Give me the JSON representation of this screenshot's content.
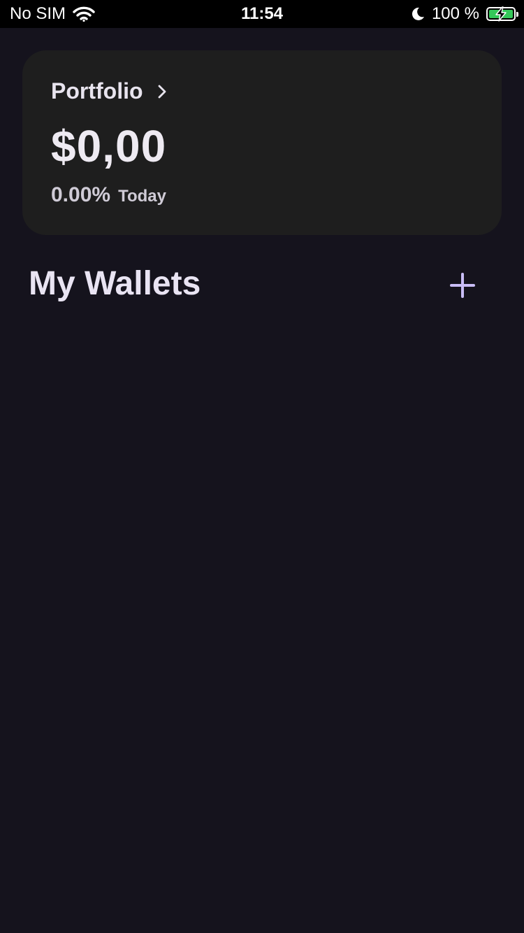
{
  "status_bar": {
    "carrier": "No SIM",
    "time": "11:54",
    "battery_percent": "100 %",
    "icons": [
      "wifi-icon",
      "moon-icon",
      "battery-charging-icon"
    ]
  },
  "portfolio": {
    "title": "Portfolio",
    "value": "$0,00",
    "change_percent": "0.00%",
    "change_period": "Today",
    "chevron_icon": "chevron-right-icon"
  },
  "wallets": {
    "title": "My Wallets",
    "add_icon": "plus-icon"
  },
  "colors": {
    "background": "#15131d",
    "card": "#1e1e1e",
    "accent": "#c9bdf6",
    "battery_green": "#34c759"
  }
}
